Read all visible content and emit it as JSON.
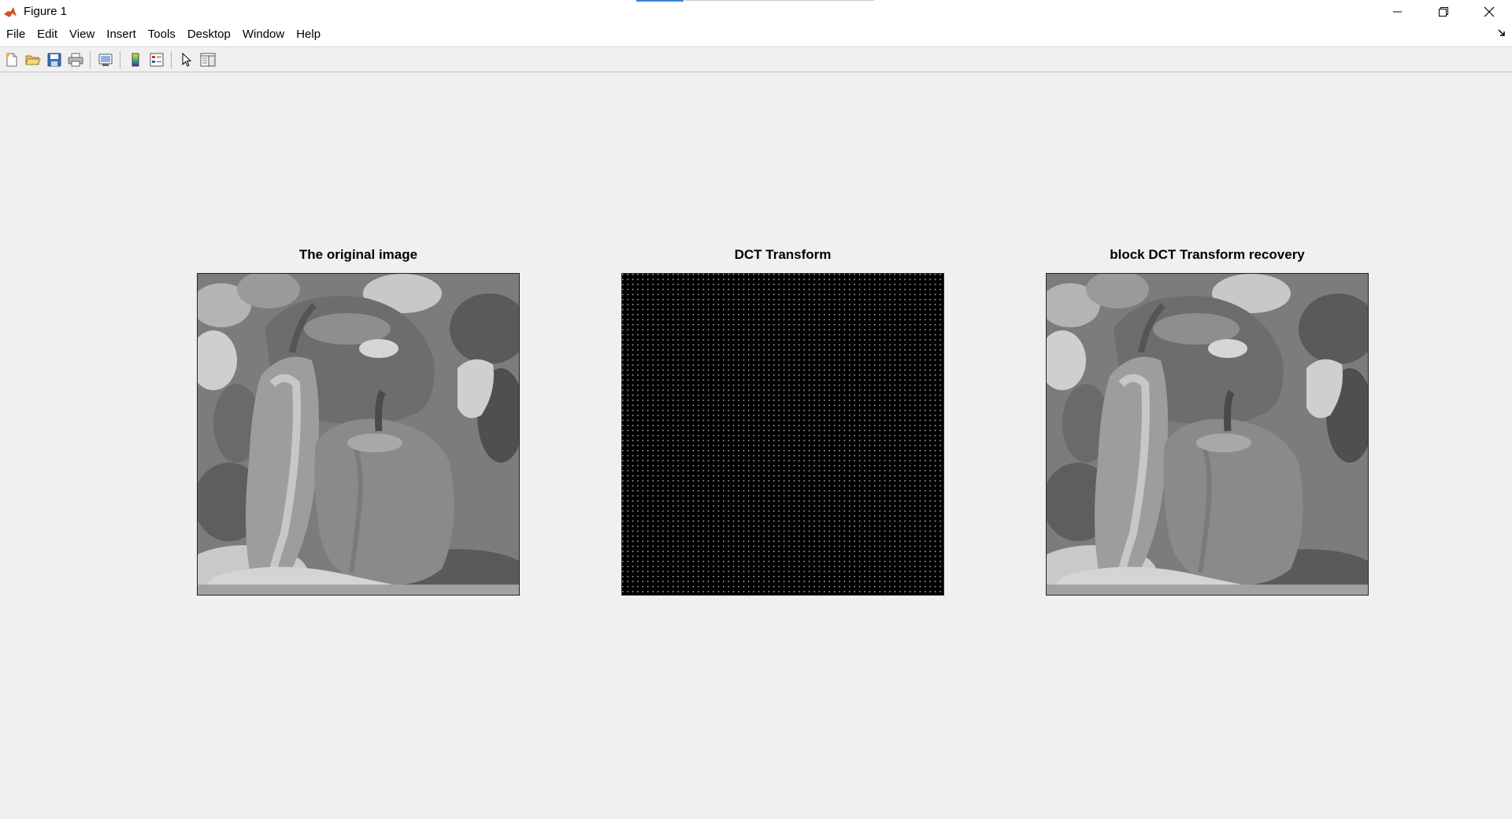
{
  "window": {
    "title": "Figure 1",
    "app_icon": "matlab-icon"
  },
  "menubar": {
    "items": [
      {
        "label": "File"
      },
      {
        "label": "Edit"
      },
      {
        "label": "View"
      },
      {
        "label": "Insert"
      },
      {
        "label": "Tools"
      },
      {
        "label": "Desktop"
      },
      {
        "label": "Window"
      },
      {
        "label": "Help"
      }
    ]
  },
  "toolbar": {
    "buttons": [
      "new-figure-icon",
      "open-file-icon",
      "save-icon",
      "print-icon",
      "print-preview-icon",
      "colorbar-icon",
      "legend-icon",
      "edit-plot-icon",
      "property-inspector-icon"
    ]
  },
  "figures": [
    {
      "title": "The original image",
      "content": "grayscale peppers photograph"
    },
    {
      "title": "DCT Transform",
      "content": "block DCT coefficients (mostly black with 8x8 grid of bright DC dots)"
    },
    {
      "title": "block DCT Transform recovery",
      "content": "reconstructed grayscale peppers photograph"
    }
  ],
  "colors": {
    "background": "#f0f0f0",
    "accent": "#3c7fd2"
  }
}
